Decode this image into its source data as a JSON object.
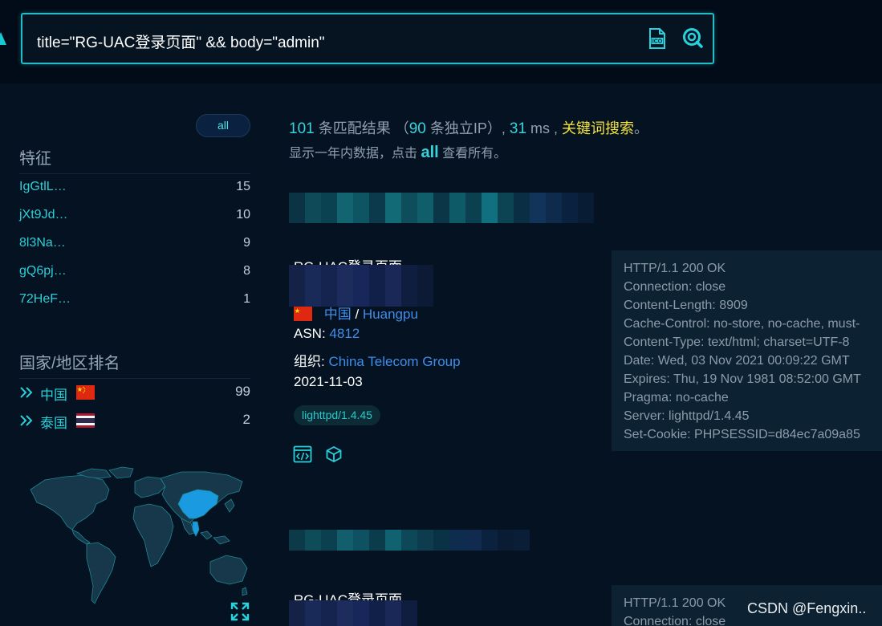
{
  "search": {
    "query": "title=\"RG-UAC登录页面\" && body=\"admin\""
  },
  "sidebar": {
    "all_label": "all",
    "features_title": "特征",
    "features": [
      {
        "label": "IgGtlL…",
        "count": "15"
      },
      {
        "label": "jXt9Jd…",
        "count": "10"
      },
      {
        "label": "8l3Na…",
        "count": "9"
      },
      {
        "label": "gQ6pj…",
        "count": "8"
      },
      {
        "label": "72HeF…",
        "count": "1"
      }
    ],
    "country_title": "国家/地区排名",
    "countries": [
      {
        "name": "中国",
        "count": "99",
        "flag": "china-flag"
      },
      {
        "name": "泰国",
        "count": "2",
        "flag": "thailand-flag"
      }
    ]
  },
  "summary": {
    "total": "101",
    "total_suffix": " 条匹配结果 （",
    "unique_ip": "90",
    "unique_suffix": " 条独立IP）, ",
    "ms": "31",
    "ms_suffix": " ms , ",
    "keyword": "关键词搜索",
    "end": "。",
    "line2_prefix": "显示一年内数据，点击 ",
    "line2_all": "all",
    "line2_suffix": " 查看所有。"
  },
  "results": [
    {
      "title": "RG-UAC登录页面",
      "location_country": "中国",
      "location_sep": " / ",
      "location_city": "Huangpu",
      "asn_label": "ASN: ",
      "asn": "4812",
      "org_label": "组织: ",
      "org": "China Telecom Group",
      "date": "2021-11-03",
      "server": "lighttpd/1.4.45",
      "headers": [
        "HTTP/1.1 200 OK",
        "Connection: close",
        "Content-Length: 8909",
        "Cache-Control: no-store, no-cache, must-",
        "Content-Type: text/html; charset=UTF-8",
        "Date: Wed, 03 Nov 2021 00:09:22 GMT",
        "Expires: Thu, 19 Nov 1981 08:52:00 GMT",
        "Pragma: no-cache",
        "Server: lighttpd/1.4.45",
        "Set-Cookie: PHPSESSID=d84ec7a09a85"
      ]
    },
    {
      "title": "RG-UAC登录页面",
      "headers": [
        "HTTP/1.1 200 OK",
        "Connection: close"
      ]
    }
  ],
  "watermark": "CSDN @Fengxin.."
}
